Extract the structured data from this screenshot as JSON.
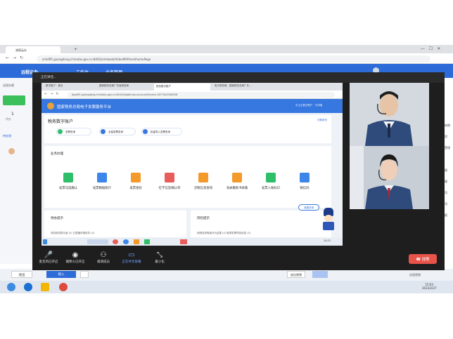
{
  "outer_browser": {
    "tab_title": "湖税云办",
    "url": "znhd95.guangdong.chinatax.gov.cn:8493/znhdweb/VideoMVPanel/homePage"
  },
  "outer_app": {
    "logo": "远程云办",
    "nav": [
      "工作台",
      "业务管理"
    ],
    "side_items": [
      "远程办理",
      "1",
      "待办",
      "待处理"
    ]
  },
  "conference": {
    "status": "正在讲话...",
    "inner_browser": {
      "tabs": [
        "数字账户 · 首页",
        "国家税务总局广东省税务局",
        "税务数字账户",
        "电子税务局 - 国家税务总局广东..."
      ],
      "url": "dppt95.guangdong.chinatax.gov.cn:8443/digital-tax-account/fecarte-1677445348458",
      "portal_title": "国家税务总局电子发票服务平台",
      "user_info": "中山王数字账户 · 已申报",
      "account_title": "税务数字账户",
      "switch": "切换身份",
      "quick_actions": [
        "发票查询",
        "全量发票查询",
        "批量导入发票查询"
      ],
      "business_title": "业务办理",
      "business_items": [
        "发票勾选确认",
        "发票数据统计",
        "发票查验",
        "红字信息确认单",
        "涉税信息查询",
        "海关缴款书采集",
        "发票入账标识",
        "微信码"
      ],
      "bottom_left_title": "待办提示",
      "bottom_left_text": "风险核查提示函 (0)      已暂缓申报抵扣 (0)",
      "bottom_right_title": "风险提示",
      "bottom_right_text": "纳税信用等级评价结果 (0)      取得发票风险信息 (0)",
      "robot_label": "我要咨询",
      "clock": "14:21"
    },
    "controls": [
      "麦克风已开启",
      "摄像头已开启",
      "邀请成员",
      "正在共享屏幕",
      "最小化"
    ],
    "hangup": "挂断"
  },
  "outer_bottom": {
    "left_button": "退出",
    "blue_button": "接入",
    "right_button": "退出视频",
    "right_text": "远程视频"
  },
  "right_sidebar_text": [
    "办电税",
    "事项",
    "已受理",
    "公",
    "受理",
    "受理",
    "公司",
    "公司",
    "申报"
  ],
  "taskbar": {
    "time": "15:03",
    "date": "2023/2/27"
  },
  "colors": {
    "brand_blue": "#2d6bd9",
    "hangup_red": "#e8534a",
    "conf_bg": "#1e1e1e"
  }
}
